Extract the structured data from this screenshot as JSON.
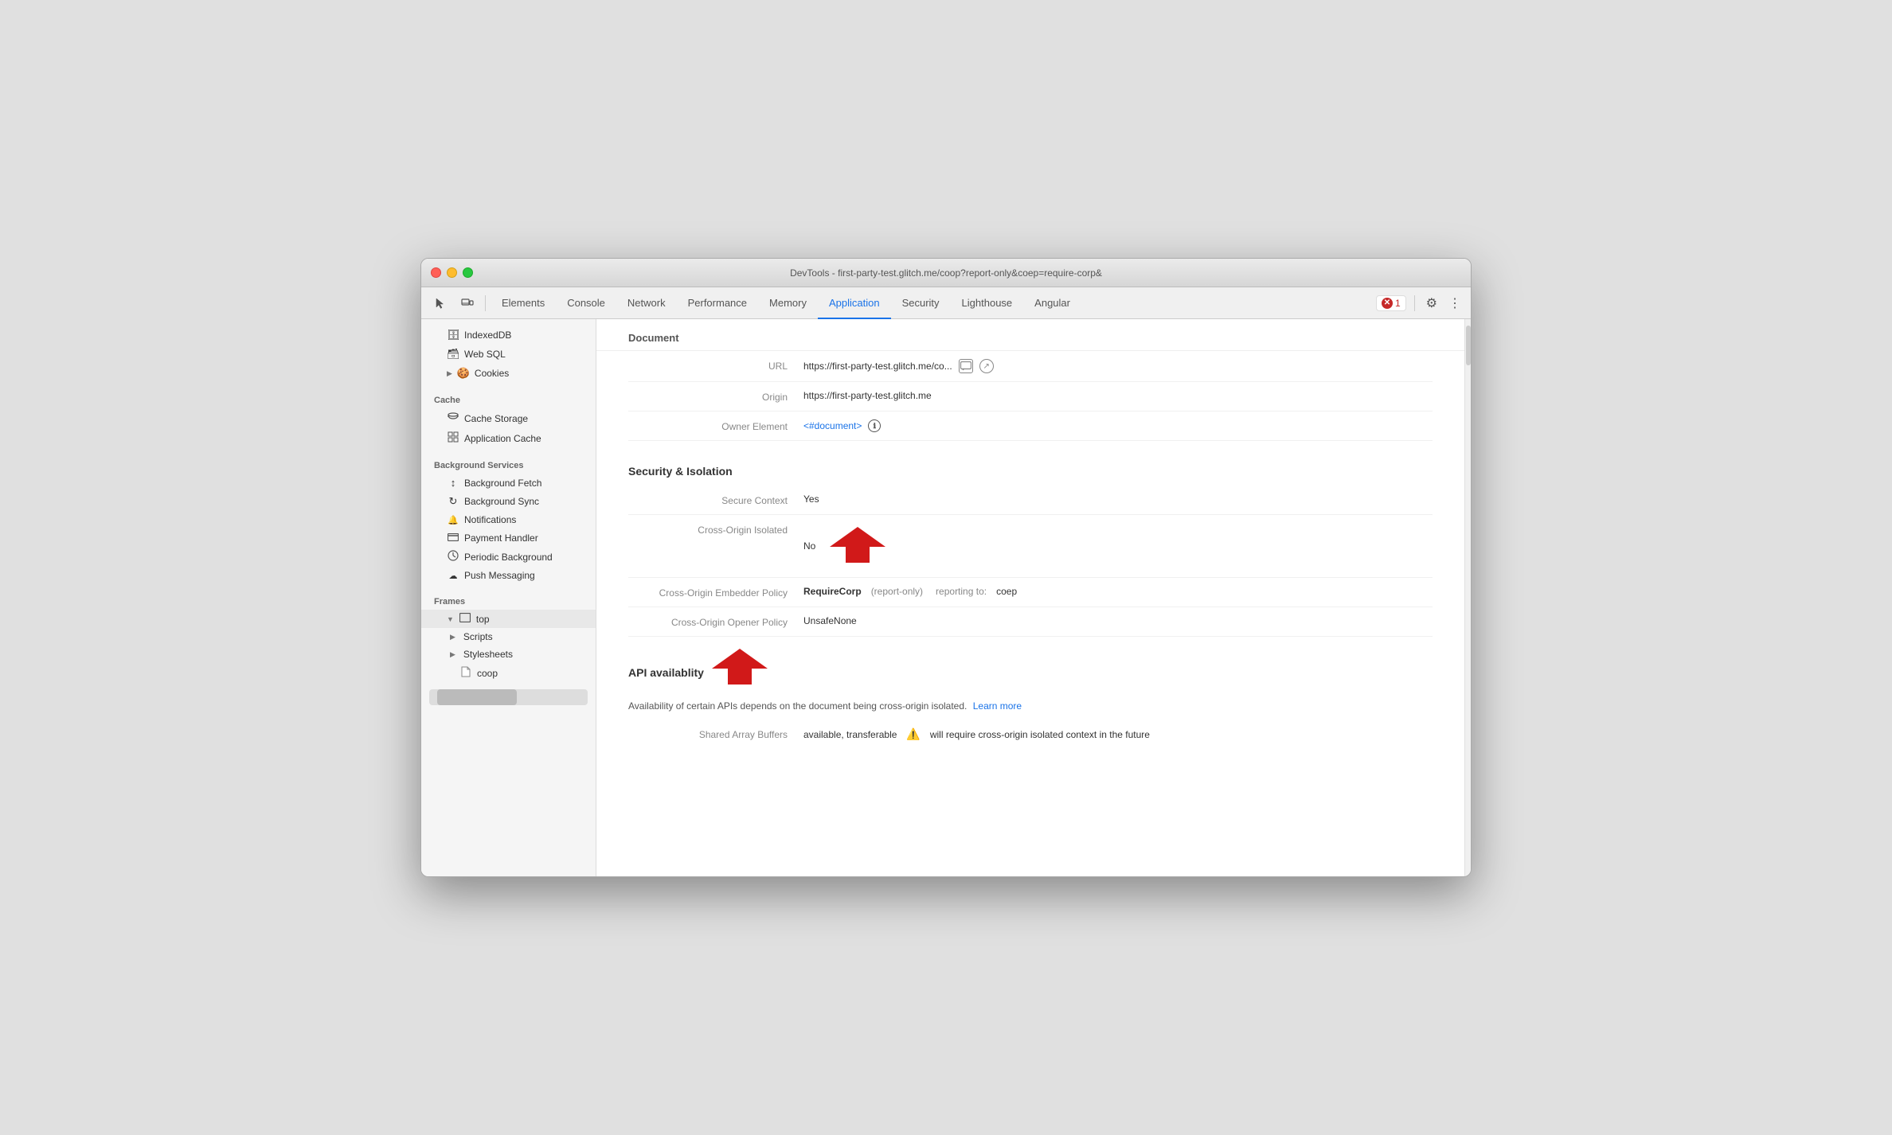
{
  "window": {
    "title": "DevTools - first-party-test.glitch.me/coop?report-only&coep=require-corp&"
  },
  "toolbar": {
    "tabs": [
      {
        "id": "elements",
        "label": "Elements",
        "active": false
      },
      {
        "id": "console",
        "label": "Console",
        "active": false
      },
      {
        "id": "network",
        "label": "Network",
        "active": false
      },
      {
        "id": "performance",
        "label": "Performance",
        "active": false
      },
      {
        "id": "memory",
        "label": "Memory",
        "active": false
      },
      {
        "id": "application",
        "label": "Application",
        "active": true
      },
      {
        "id": "security",
        "label": "Security",
        "active": false
      },
      {
        "id": "lighthouse",
        "label": "Lighthouse",
        "active": false
      },
      {
        "id": "angular",
        "label": "Angular",
        "active": false
      }
    ],
    "error_count": "1",
    "more_label": "⋮"
  },
  "sidebar": {
    "sections": [
      {
        "id": "storage",
        "items": [
          {
            "id": "indexeddb",
            "label": "IndexedDB",
            "icon": "🗄"
          },
          {
            "id": "websql",
            "label": "Web SQL",
            "icon": "🗃"
          },
          {
            "id": "cookies",
            "label": "Cookies",
            "icon": "🍪",
            "expandable": true
          }
        ]
      },
      {
        "id": "cache",
        "label": "Cache",
        "items": [
          {
            "id": "cache-storage",
            "label": "Cache Storage",
            "icon": "🗄"
          },
          {
            "id": "application-cache",
            "label": "Application Cache",
            "icon": "▦"
          }
        ]
      },
      {
        "id": "background-services",
        "label": "Background Services",
        "items": [
          {
            "id": "background-fetch",
            "label": "Background Fetch",
            "icon": "↕"
          },
          {
            "id": "background-sync",
            "label": "Background Sync",
            "icon": "↻"
          },
          {
            "id": "notifications",
            "label": "Notifications",
            "icon": "🔔"
          },
          {
            "id": "payment-handler",
            "label": "Payment Handler",
            "icon": "▬"
          },
          {
            "id": "periodic-background",
            "label": "Periodic Background",
            "icon": "⏱"
          },
          {
            "id": "push-messaging",
            "label": "Push Messaging",
            "icon": "☁"
          }
        ]
      },
      {
        "id": "frames",
        "label": "Frames",
        "items": [
          {
            "id": "top",
            "label": "top",
            "expandable": true,
            "expanded": true
          },
          {
            "id": "scripts",
            "label": "Scripts",
            "expandable": true,
            "indent": 1
          },
          {
            "id": "stylesheets",
            "label": "Stylesheets",
            "expandable": true,
            "indent": 1
          },
          {
            "id": "coop",
            "label": "coop",
            "indent": 2,
            "icon": "📄"
          }
        ]
      }
    ]
  },
  "main": {
    "document_section": {
      "label": "Document"
    },
    "url_label": "URL",
    "url_value": "https://first-party-test.glitch.me/co...",
    "origin_label": "Origin",
    "origin_value": "https://first-party-test.glitch.me",
    "owner_element_label": "Owner Element",
    "owner_element_value": "<#document>",
    "security_section_title": "Security & Isolation",
    "secure_context_label": "Secure Context",
    "secure_context_value": "Yes",
    "cross_origin_isolated_label": "Cross-Origin Isolated",
    "cross_origin_isolated_value": "No",
    "coep_label": "Cross-Origin Embedder Policy",
    "coep_value": "RequireCorp",
    "coep_detail": "(report-only)",
    "coep_reporting_label": "reporting to:",
    "coep_reporting_value": "coep",
    "coop_label": "Cross-Origin Opener Policy",
    "coop_value": "UnsafeNone",
    "api_section_title": "API availablity",
    "api_section_desc_pre": "Availability of certain APIs depends on the document being cross-origin isolated.",
    "api_learn_more": "Learn more",
    "shared_array_label": "Shared Array Buffers",
    "shared_array_value": "available, transferable",
    "shared_array_warning": "will require cross-origin isolated context in the future"
  }
}
